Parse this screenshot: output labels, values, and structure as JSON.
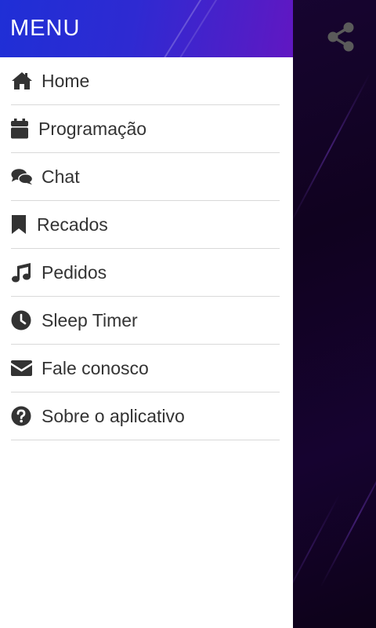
{
  "drawer": {
    "title": "MENU",
    "items": [
      {
        "label": "Home",
        "icon": "home-icon"
      },
      {
        "label": "Programação",
        "icon": "calendar-icon"
      },
      {
        "label": "Chat",
        "icon": "chat-icon"
      },
      {
        "label": "Recados",
        "icon": "bookmark-icon"
      },
      {
        "label": "Pedidos",
        "icon": "music-note-icon"
      },
      {
        "label": "Sleep Timer",
        "icon": "clock-icon"
      },
      {
        "label": "Fale conosco",
        "icon": "envelope-icon"
      },
      {
        "label": "Sobre o aplicativo",
        "icon": "question-circle-icon"
      }
    ]
  },
  "share": {
    "icon": "share-icon"
  },
  "colors": {
    "header_gradient_start": "#1f2fd6",
    "header_gradient_end": "#6117c2",
    "background": "#10021f",
    "icon": "#333333",
    "text": "#333333",
    "divider": "#d9d9d9"
  }
}
